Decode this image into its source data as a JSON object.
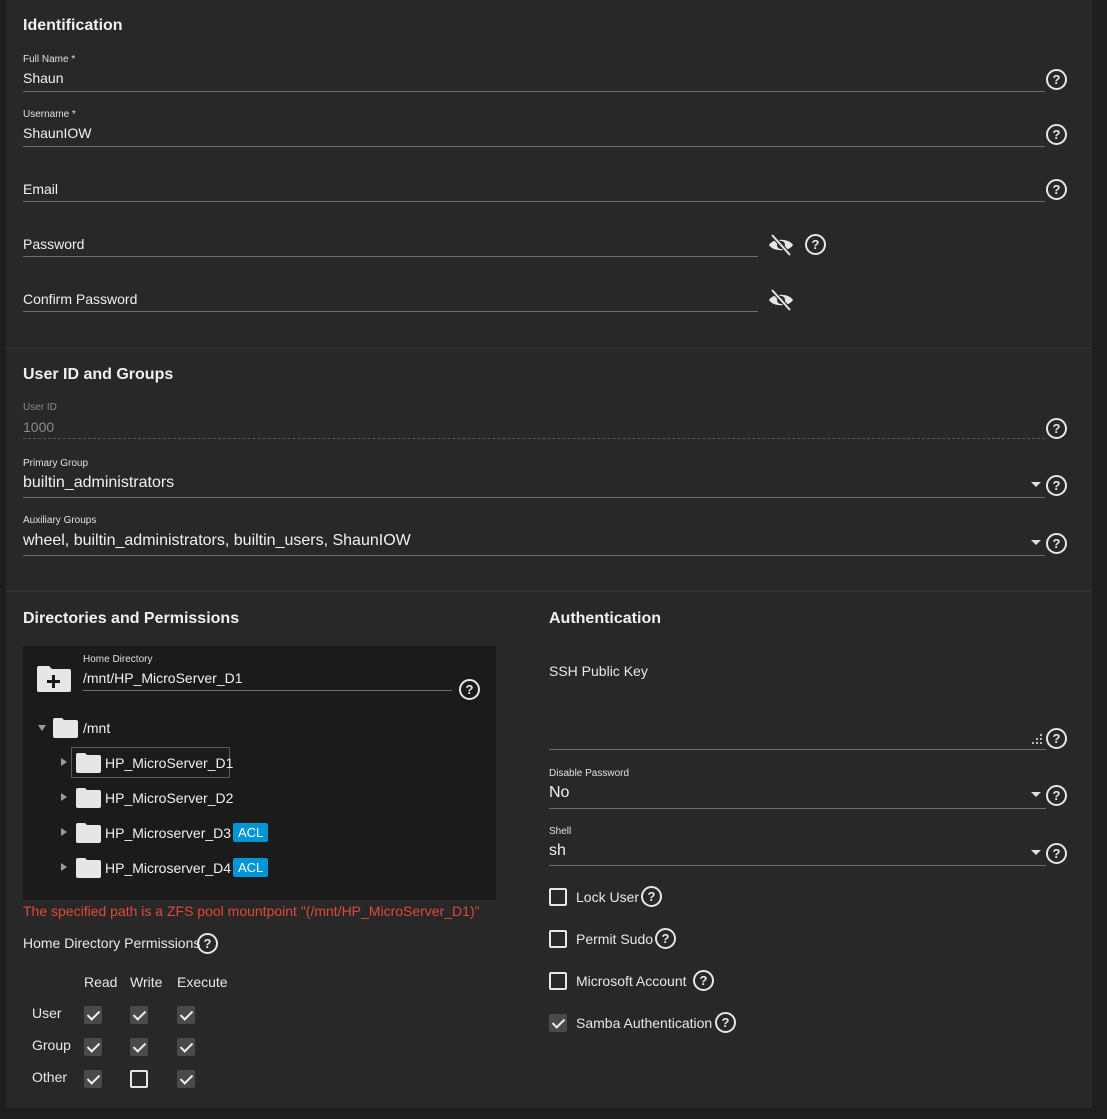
{
  "identification": {
    "title": "Identification",
    "full_name_label": "Full Name *",
    "full_name_value": "Shaun",
    "username_label": "Username *",
    "username_value": "ShaunIOW",
    "email_label": "Email",
    "password_label": "Password",
    "confirm_password_label": "Confirm Password"
  },
  "user_id_groups": {
    "title": "User ID and Groups",
    "user_id_label": "User ID",
    "user_id_value": "1000",
    "primary_group_label": "Primary Group",
    "primary_group_value": "builtin_administrators",
    "aux_groups_label": "Auxiliary Groups",
    "aux_groups_value": "wheel, builtin_administrators, builtin_users, ShaunIOW"
  },
  "directories": {
    "title": "Directories and Permissions",
    "home_dir_label": "Home Directory",
    "home_dir_value": "/mnt/HP_MicroServer_D1",
    "tree": {
      "root": "/mnt",
      "children": [
        {
          "label": "HP_MicroServer_D1",
          "acl": ""
        },
        {
          "label": "HP_MicroServer_D2",
          "acl": ""
        },
        {
          "label": "HP_Microserver_D3",
          "acl": "ACL"
        },
        {
          "label": "HP_Microserver_D4",
          "acl": "ACL"
        }
      ]
    },
    "error": "The specified path is a ZFS pool mountpoint \"(/mnt/HP_MicroServer_D1)\"",
    "perms_label": "Home Directory Permissions",
    "perm_cols": [
      "Read",
      "Write",
      "Execute"
    ],
    "perm_rows": [
      {
        "label": "User",
        "values": [
          true,
          true,
          true
        ]
      },
      {
        "label": "Group",
        "values": [
          true,
          true,
          true
        ]
      },
      {
        "label": "Other",
        "values": [
          true,
          false,
          true
        ]
      }
    ]
  },
  "authentication": {
    "title": "Authentication",
    "ssh_key_label": "SSH Public Key",
    "disable_password_label": "Disable Password",
    "disable_password_value": "No",
    "shell_label": "Shell",
    "shell_value": "sh",
    "checkboxes": [
      {
        "label": "Lock User",
        "checked": false
      },
      {
        "label": "Permit Sudo",
        "checked": false
      },
      {
        "label": "Microsoft Account",
        "checked": false
      },
      {
        "label": "Samba Authentication",
        "checked": true
      }
    ]
  },
  "icons": {
    "help": "help-circle-icon",
    "visibility": "eye-off-icon",
    "folder": "folder-icon",
    "new_folder": "folder-plus-icon",
    "dropdown": "caret-down-icon",
    "resize": "resize-handle-icon"
  },
  "colors": {
    "background": "#1e1e1e",
    "card": "#282828",
    "accent": "#0095d5",
    "error": "#e0483c"
  }
}
